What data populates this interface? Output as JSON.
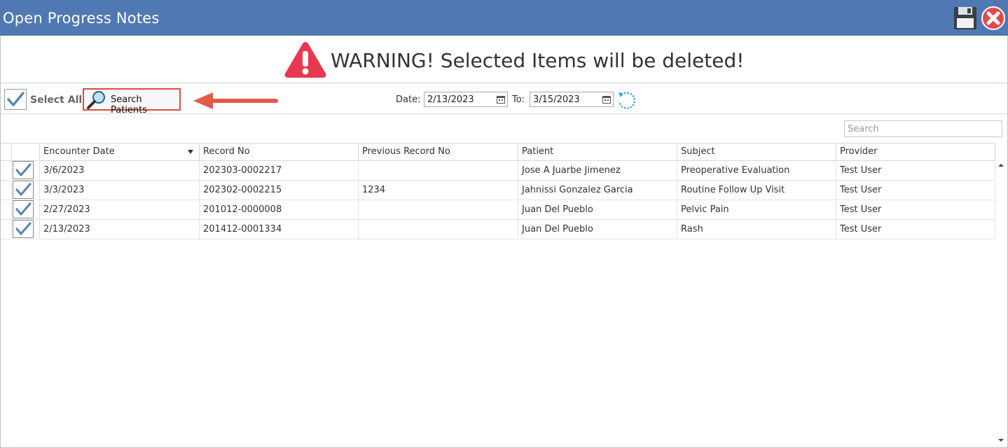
{
  "window": {
    "title": "Open Progress Notes"
  },
  "warning": {
    "text": "WARNING! Selected Items will be deleted!"
  },
  "toolbar": {
    "select_all_label": "Select All",
    "search_patients_label": "Search Patients",
    "date_label": "Date:",
    "date_from": "2/13/2023",
    "to_label": "To:",
    "date_to": "3/15/2023"
  },
  "grid": {
    "search_placeholder": "Search",
    "columns": [
      "Encounter Date",
      "Record No",
      "Previous Record No",
      "Patient",
      "Subject",
      "Provider"
    ],
    "rows": [
      {
        "checked": true,
        "encounter_date": "3/6/2023",
        "record_no": "202303-0002217",
        "previous_record_no": "",
        "patient": "Jose A Juarbe Jimenez",
        "subject": "Preoperative Evaluation",
        "provider": "Test User"
      },
      {
        "checked": true,
        "encounter_date": "3/3/2023",
        "record_no": "202302-0002215",
        "previous_record_no": "1234",
        "patient": "Jahnissi Gonzalez Garcia",
        "subject": "Routine Follow Up Visit",
        "provider": "Test User"
      },
      {
        "checked": true,
        "encounter_date": "2/27/2023",
        "record_no": "201012-0000008",
        "previous_record_no": "",
        "patient": "Juan Del Pueblo",
        "subject": "Pelvic Pain",
        "provider": "Test User"
      },
      {
        "checked": true,
        "encounter_date": "2/13/2023",
        "record_no": "201412-0001334",
        "previous_record_no": "",
        "patient": "Juan Del Pueblo",
        "subject": "Rash",
        "provider": "Test User"
      }
    ]
  },
  "colors": {
    "titlebar": "#5079b3",
    "warning_red": "#e8384f",
    "highlight_red": "#e04a3c",
    "check_blue": "#5b86b8"
  }
}
